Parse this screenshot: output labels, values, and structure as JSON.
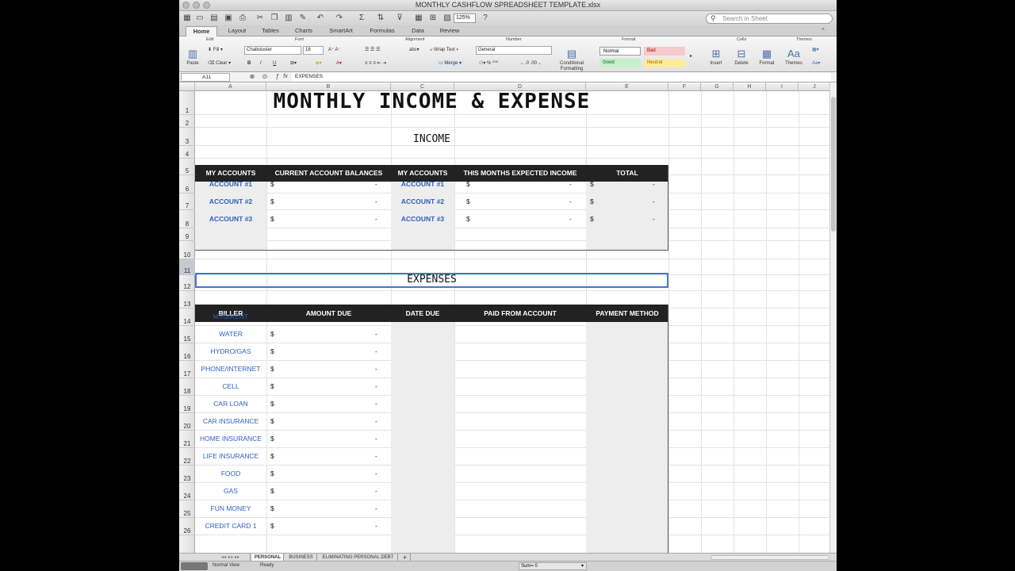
{
  "window": {
    "title": "MONTHLY CASHFLOW SPREADSHEET TEMPLATE.xlsx"
  },
  "toolbar": {
    "zoom": "125%",
    "search_placeholder": "Search in Sheet"
  },
  "ribbon_tabs": [
    "Home",
    "Layout",
    "Tables",
    "Charts",
    "SmartArt",
    "Formulas",
    "Data",
    "Review"
  ],
  "ribbon": {
    "groups": [
      "Edit",
      "Font",
      "Alignment",
      "Number",
      "Format",
      "Cells",
      "Themes"
    ],
    "paste": "Paste",
    "fill": "Fill",
    "clear": "Clear",
    "font_name": "Chalkduster",
    "font_size": "18",
    "wrap_text": "Wrap Text",
    "merge": "Merge",
    "number_format": "General",
    "conditional_formatting": "Conditional Formatting",
    "styles": {
      "normal": "Normal",
      "bad": "Bad",
      "good": "Good",
      "neutral": "Neutral"
    },
    "insert": "Insert",
    "delete": "Delete",
    "format": "Format",
    "themes": "Themes"
  },
  "formula_bar": {
    "cell_ref": "A11",
    "content": "EXPENSES"
  },
  "columns": [
    "A",
    "B",
    "C",
    "D",
    "E",
    "F",
    "G",
    "H",
    "I",
    "J"
  ],
  "rows": [
    "1",
    "2",
    "3",
    "4",
    "5",
    "6",
    "7",
    "8",
    "9",
    "10",
    "11",
    "12",
    "13",
    "14",
    "15",
    "16",
    "17",
    "18",
    "19",
    "20",
    "21",
    "22",
    "23",
    "24",
    "25",
    "26"
  ],
  "sheet": {
    "title": "MONTHLY INCOME & EXPENSE",
    "income_title": "INCOME",
    "income_headers": [
      "MY ACCOUNTS",
      "CURRENT ACCOUNT BALANCES",
      "MY ACCOUNTS",
      "THIS MONTHS EXPECTED INCOME",
      "TOTAL"
    ],
    "income_accounts": [
      "ACCOUNT #1",
      "ACCOUNT #2",
      "ACCOUNT #3"
    ],
    "currency": "$",
    "empty_value": "-",
    "expenses_title": "EXPENSES",
    "expense_headers": [
      "BILLER",
      "AMOUNT DUE",
      "DATE DUE",
      "PAID FROM ACCOUNT",
      "PAYMENT METHOD"
    ],
    "billers": [
      "MTG/RENT",
      "WATER",
      "HYDRO/GAS",
      "PHONE/INTERNET",
      "CELL",
      "CAR LOAN",
      "CAR INSURANCE",
      "HOME INSURANCE",
      "LIFE INSURANCE",
      "FOOD",
      "GAS",
      "FUN MONEY",
      "CREDIT CARD 1"
    ]
  },
  "sheet_tabs": [
    "PERSONAL",
    "BUSINESS",
    "ELIMINATING PERSONAL DEBT"
  ],
  "status": {
    "view": "Normal View",
    "ready": "Ready",
    "sum": "Sum= 0"
  }
}
